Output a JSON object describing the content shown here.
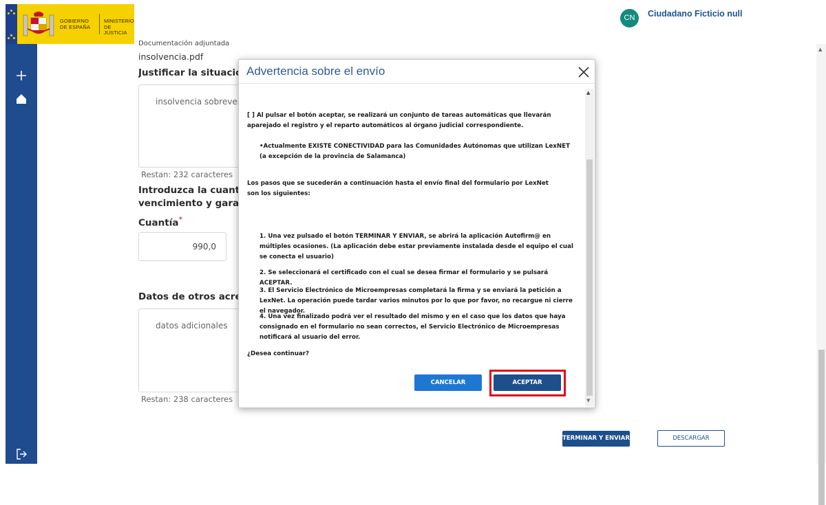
{
  "header": {
    "logo": {
      "gobierno": "GOBIERNO DE ESPAÑA",
      "ministerio": "MINISTERIO DE JUSTICIA"
    },
    "user": {
      "initials": "CN",
      "name": "Ciudadano Ficticio null"
    }
  },
  "sidebar": {
    "icons": [
      "plus-icon",
      "home-icon",
      "logout-icon"
    ]
  },
  "form": {
    "attachment_label": "Documentación adjuntada",
    "attachment_file": "insolvencia.pdf",
    "justify_label": "Justificar la situación de",
    "justify_value": "insolvencia sobreveni",
    "justify_remaining": "Restan: 232 caracteres",
    "amount_question_line1": "Introduzca la cuantía to",
    "amount_question_line2": "vencimiento y garantía",
    "amount_label": "Cuantía",
    "required_mark": "*",
    "amount_value": "990,0",
    "other_creditors_label": "Datos de otros acreedo",
    "other_creditors_placeholder": "datos adicionales",
    "other_remaining": "Restan: 238 caracteres"
  },
  "footer_buttons": {
    "terminar": "TERMINAR Y ENVIAR",
    "descargar": "DESCARGAR"
  },
  "modal": {
    "title": "Advertencia sobre el envío",
    "p1": "[ ] Al pulsar el botón aceptar, se realizará un conjunto de tareas automáticas que  llevarán aparejado el registro y el reparto automáticos al órgano judicial correspondiente.",
    "p2": "•Actualmente EXISTE CONECTIVIDAD para las Comunidades Autónomas que utilizan LexNET (a excepción de la provincia de Salamanca)",
    "p3": "Los pasos que se sucederán a continuación hasta el envío final del formulario por LexNet son los siguientes:",
    "step1": "1.   Una vez pulsado el botón TERMINAR Y ENVIAR, se abrirá la aplicación Autofirm@ en múltiples ocasiones. (La aplicación debe estar previamente instalada desde el equipo el cual se conecta el usuario)",
    "step2": "2.   Se seleccionará el certificado con el cual se desea firmar el formulario y se pulsará ACEPTAR.",
    "step3": "3.   El Servicio Electrónico de Microempresas completará la firma y se enviará la petición a LexNet. La operación puede tardar varios minutos por lo que por favor, no recargue ni cierre el navegador.",
    "step4": "4.   Una vez finalizado podrá ver el resultado del mismo y en el caso que los datos que haya consignado en el formulario no sean correctos, el Servicio Electrónico de Microempresas notificará al usuario del error.",
    "question": "¿Desea continuar?",
    "cancel_label": "CANCELAR",
    "accept_label": "ACEPTAR"
  },
  "colors": {
    "sidebar": "#1f4b8f",
    "primary": "#1c4f8c",
    "cancel": "#1e78d3",
    "highlight": "#e30613",
    "logo_yellow": "#f6d100"
  }
}
